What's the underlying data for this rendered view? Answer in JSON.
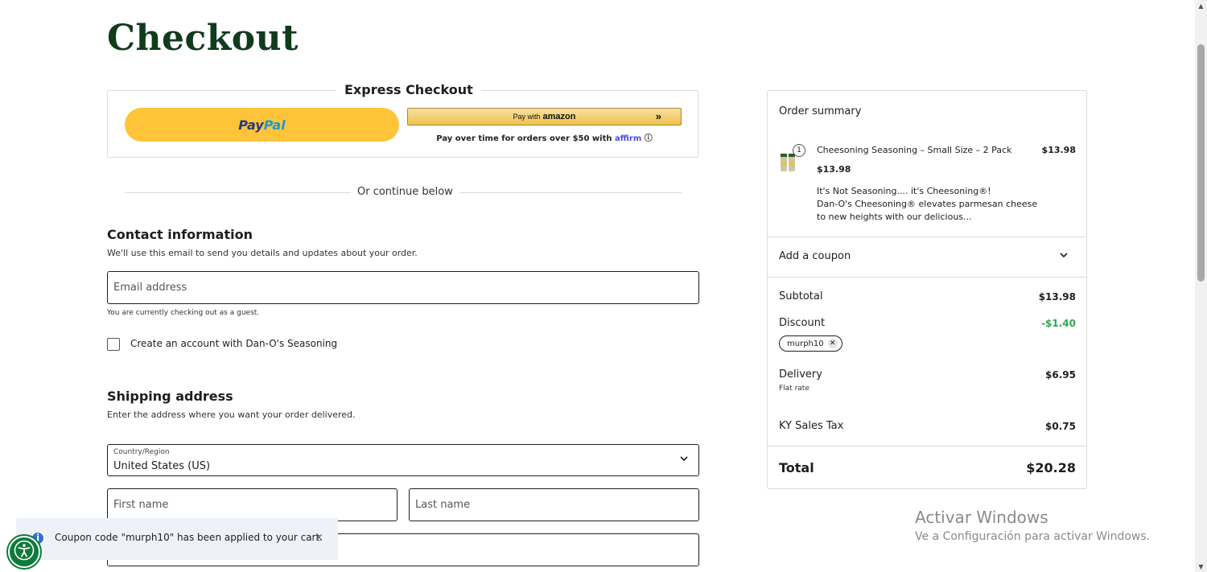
{
  "page": {
    "title": "Checkout"
  },
  "express": {
    "heading": "Express Checkout",
    "paypal_part1": "Pay",
    "paypal_part2": "Pal",
    "amazon_text": "Pay with",
    "amazon_brand": "amazon",
    "amazon_arrow": "»",
    "affirm_text": "Pay over time for orders over $50 with",
    "affirm_brand": "affirm",
    "affirm_info": "ⓘ",
    "divider_text": "Or continue below"
  },
  "contact": {
    "title": "Contact information",
    "description": "We'll use this email to send you details and updates about your order.",
    "email_placeholder": "Email address",
    "guest_note": "You are currently checking out as a guest.",
    "create_account_label": "Create an account with Dan-O's Seasoning"
  },
  "shipping": {
    "title": "Shipping address",
    "description": "Enter the address where you want your order delivered.",
    "country_label": "Country/Region",
    "country_value": "United States (US)",
    "first_name_placeholder": "First name",
    "last_name_placeholder": "Last name"
  },
  "summary": {
    "title": "Order summary",
    "product": {
      "quantity": "1",
      "name": "Cheesoning Seasoning – Small Size – 2 Pack",
      "line_total": "$13.98",
      "unit_price": "$13.98",
      "description_line1": "It's Not Seasoning.... it's Cheesoning®!",
      "description_line2": "Dan-O's Cheesoning® elevates parmesan cheese",
      "description_line3": "to new heights with our delicious..."
    },
    "coupon_toggle": "Add a coupon",
    "subtotal_label": "Subtotal",
    "subtotal_value": "$13.98",
    "discount_label": "Discount",
    "discount_value": "-$1.40",
    "coupon_code": "murph10",
    "delivery_label": "Delivery",
    "delivery_value": "$6.95",
    "delivery_method": "Flat rate",
    "tax_label": "KY Sales Tax",
    "tax_value": "$0.75",
    "total_label": "Total",
    "total_value": "$20.28"
  },
  "toast": {
    "message": "Coupon code \"murph10\" has been applied to your cart.",
    "close": "×",
    "info": "i"
  },
  "watermark": {
    "line1": "Activar Windows",
    "line2": "Ve a Configuración para activar Windows."
  },
  "colors": {
    "title_green": "#103b1c",
    "paypal_yellow": "#ffc439",
    "discount_green": "#2fa84f",
    "accessibility_green": "#0e7a3c"
  }
}
